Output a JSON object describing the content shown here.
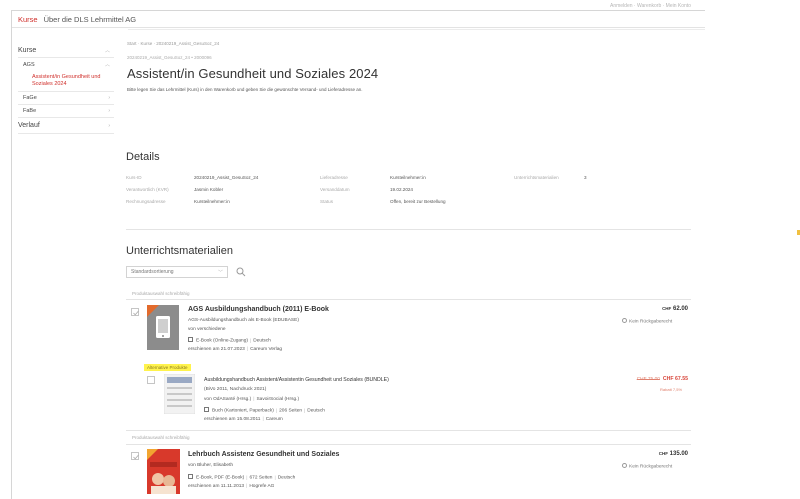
{
  "topbar": {
    "brand": "Kurse",
    "link": "Über die DLS Lehrmittel AG",
    "right_text": "Anmelden · Warenkorb · Mein Konto"
  },
  "sidebar": {
    "items": [
      {
        "label": "Kurse"
      },
      {
        "label": "AGS"
      },
      {
        "label": "Assistent/in Gesundheit und Soziales 2024"
      },
      {
        "label": "FaGe"
      },
      {
        "label": "FaBe"
      },
      {
        "label": "Verlauf"
      }
    ]
  },
  "main": {
    "breadcrumb": "Start · Kurse · 20240219_Assist_GesuSoz_24",
    "sub_id": "20240219_Assist_GesuSoz_24 • 2000096",
    "title": "Assistent/in Gesundheit und Soziales 2024",
    "intro": "Bitte legen Sie das Lehrmittel (Kurs) in den Warenkorb und geben Sie die gewünschte Versand- und Lieferadresse an."
  },
  "details": {
    "heading": "Details",
    "rows": [
      [
        {
          "label": "Kurs-ID",
          "value": "20240219_Assist_GesuSoz_24"
        },
        {
          "label": "Lieferadresse",
          "value": "Kursteilnehmer:in"
        },
        {
          "label": "Unterrichtsmaterialien",
          "value": "3"
        }
      ],
      [
        {
          "label": "Verantwortlich (KVR)",
          "value": "Jasmin Kobler"
        },
        {
          "label": "Versanddatum",
          "value": "19.02.2024"
        }
      ],
      [
        {
          "label": "Rechnungsadresse",
          "value": "Kursteilnehmer:in"
        },
        {
          "label": "Status",
          "value": "Offen, bereit zur Bestellung"
        }
      ]
    ]
  },
  "materials": {
    "heading": "Unterrichtsmaterialien",
    "sort_value": "Standardsortierung",
    "hint": "Produktauswahl schreibfähig",
    "products": [
      {
        "title": "AGS Ausbildungshandbuch (2011) E-Book",
        "lines": [
          "AGS-Ausbildungshandbuch als E-Book (EDUBASE)",
          "von verschiedene"
        ],
        "format_line": [
          "E-Book (Online-Zugang)",
          "Deutsch"
        ],
        "date_line": [
          "erschienen am 21.07.2023",
          "Careum Verlag"
        ],
        "price": "62.00",
        "currency": "CHF",
        "refund": "Kein Rückgaberecht"
      },
      {
        "title": "Lehrbuch Assistenz Gesundheit und Soziales",
        "lines": [
          "von Bluher, Elisabeth"
        ],
        "format_line": [
          "E-Book, PDF (E-Book)",
          "672 Seiten",
          "Deutsch"
        ],
        "date_line": [
          "erschienen am 11.11.2013",
          "Hogrefe AG"
        ],
        "price": "135.00",
        "currency": "CHF",
        "refund": "Kein Rückgaberecht"
      }
    ],
    "alternative": {
      "badge": "Alternative Produkte",
      "title": "Ausbildungshandbuch Assistent/Assistentin Gesundheit und Soziales (BUNDLE)",
      "lines": [
        "(BiVo 2011, Nachdruck 2021)"
      ],
      "publisher_line": [
        "von OdASanté (Hrsg.)",
        "SavoirSocial (Hrsg.)"
      ],
      "format_line": [
        "Buch (Kartoniert, Paperback)",
        "206 Seiten",
        "Deutsch"
      ],
      "date_line": [
        "erschienen am 15.08.2011",
        "Careum"
      ],
      "old_price": "CHF 75.00",
      "new_price": "CHF 67.55",
      "rabatt": "Rabatt 7,5%"
    }
  },
  "colors": {
    "accent": "#d0302c",
    "highlight": "#fff34d"
  }
}
